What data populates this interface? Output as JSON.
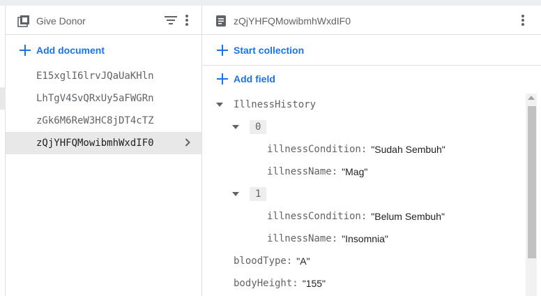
{
  "left_panel": {
    "title": "Give Donor",
    "add_document_label": "Add document",
    "documents": [
      {
        "id": "E15xglI6lrvJQaUaKHln",
        "selected": false
      },
      {
        "id": "LhTgV4SvQRxUy5aFWGRn",
        "selected": false
      },
      {
        "id": "zGk6M6ReW3HC8jDT4cTZ",
        "selected": false
      },
      {
        "id": "zQjYHFQMowibmhWxdIF0",
        "selected": true
      }
    ]
  },
  "right_panel": {
    "title": "zQjYHFQMowibmhWxdIF0",
    "start_collection_label": "Start collection",
    "add_field_label": "Add field",
    "fields": {
      "illness_history_key": "IllnessHistory",
      "items": [
        {
          "index": "0",
          "condition_key": "illnessCondition:",
          "condition_value": "\"Sudah Sembuh\"",
          "name_key": "illnessName:",
          "name_value": "\"Mag\""
        },
        {
          "index": "1",
          "condition_key": "illnessCondition:",
          "condition_value": "\"Belum Sembuh\"",
          "name_key": "illnessName:",
          "name_value": "\"Insomnia\""
        }
      ],
      "blood_type_key": "bloodType:",
      "blood_type_value": "\"A\"",
      "body_height_key": "bodyHeight:",
      "body_height_value": "\"155\""
    }
  },
  "colors": {
    "accent": "#1a73e8",
    "muted": "#5f6368",
    "selected_bg": "#e8e8e8",
    "border": "#e0e0e0"
  }
}
